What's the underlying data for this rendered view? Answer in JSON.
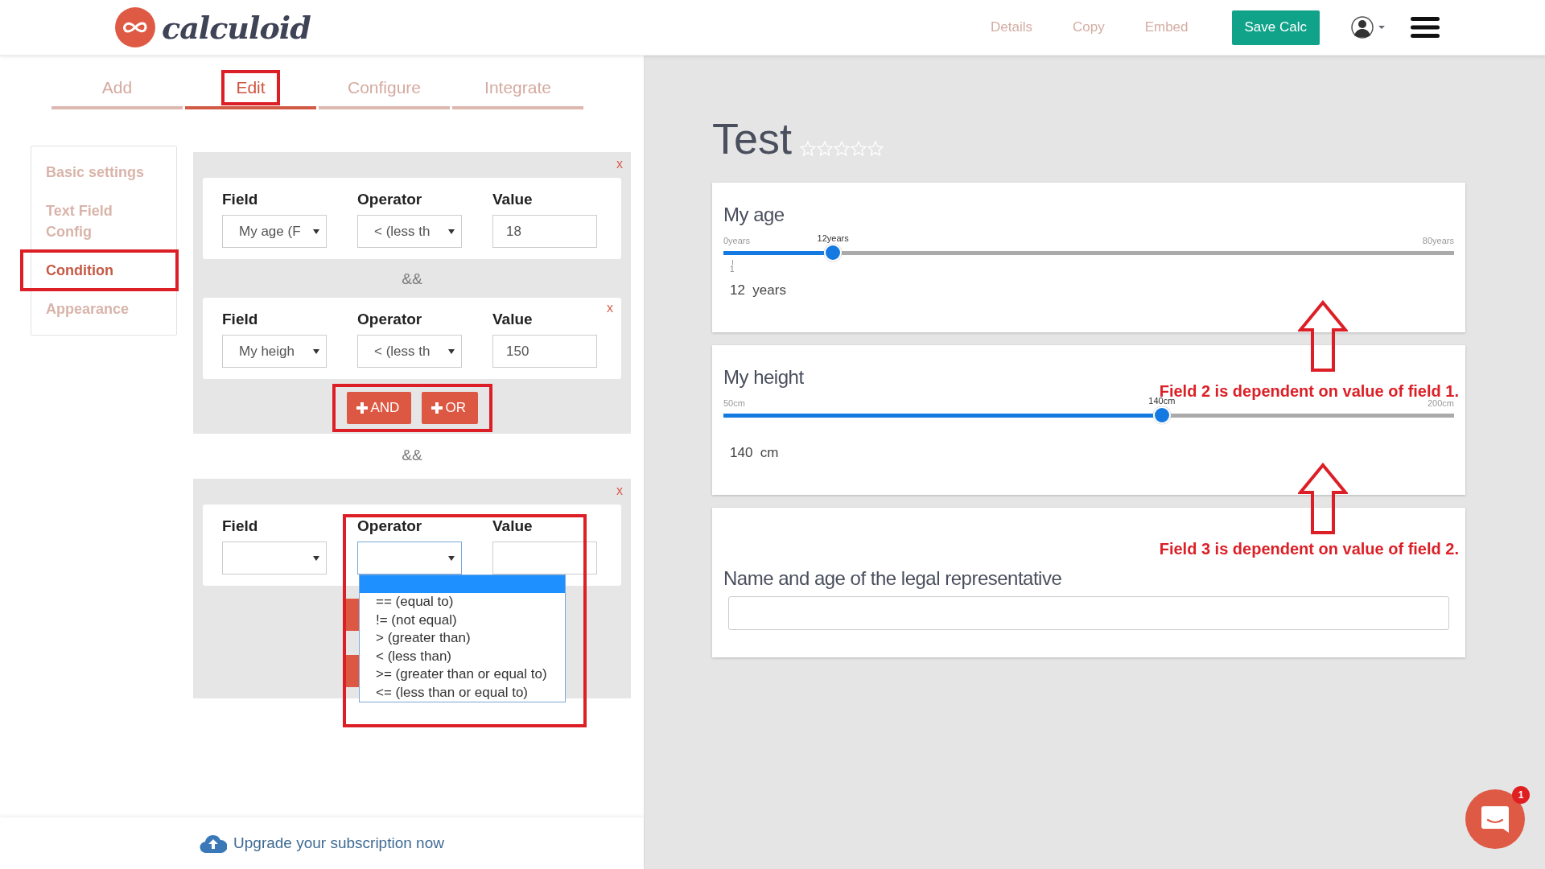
{
  "header": {
    "logo_text": "calculoid",
    "nav": [
      "Details",
      "Copy",
      "Embed"
    ],
    "save_button": "Save Calc"
  },
  "tabs": [
    {
      "label": "Add",
      "selected": false,
      "highlighted": false
    },
    {
      "label": "Edit",
      "selected": true,
      "highlighted": true
    },
    {
      "label": "Configure",
      "selected": false,
      "highlighted": false
    },
    {
      "label": "Integrate",
      "selected": false,
      "highlighted": false
    }
  ],
  "sidebar": {
    "items": [
      {
        "label": "Basic settings",
        "selected": false,
        "highlighted": false
      },
      {
        "label": "Text Field Config",
        "selected": false,
        "highlighted": false
      },
      {
        "label": "Condition",
        "selected": true,
        "highlighted": true
      },
      {
        "label": "Appearance",
        "selected": false,
        "highlighted": false
      }
    ]
  },
  "condition_groups": [
    {
      "close": "x",
      "rules": [
        {
          "labels": [
            "Field",
            "Operator",
            "Value"
          ],
          "field": "My age (F",
          "operator": "< (less th",
          "value": "18",
          "highlighted": false
        },
        {
          "labels": [
            "Field",
            "Operator",
            "Value"
          ],
          "field": "My heigh",
          "operator": "< (less th",
          "value": "150",
          "remove": "x",
          "highlighted": false
        }
      ],
      "joiner": "&&",
      "buttons": {
        "highlighted": true,
        "items": [
          {
            "kind": "and",
            "label": "AND"
          },
          {
            "kind": "or",
            "label": "OR"
          }
        ]
      }
    },
    {
      "close": "x",
      "rules": [
        {
          "labels": [
            "Field",
            "Operator",
            "Value"
          ],
          "highlighted": true,
          "dropdown": {
            "blank_selected": true,
            "options": [
              {
                "label": "== (equal to)",
                "selected": false
              },
              {
                "label": "!= (not equal)",
                "selected": false
              },
              {
                "label": "> (greater than)",
                "selected": false
              },
              {
                "label": "< (less than)",
                "selected": false
              },
              {
                "label": ">= (greater than or equal to)",
                "selected": false
              },
              {
                "label": "<= (less than or equal to)",
                "selected": false
              }
            ]
          }
        }
      ],
      "buttons": {
        "items": [
          {
            "kind": "and"
          },
          {
            "kind": "or"
          }
        ]
      }
    }
  ],
  "group_joiner": "&&",
  "footer": {
    "upgrade_link": "Upgrade your subscription now"
  },
  "preview": {
    "title": "Test",
    "stars": 0,
    "fields": [
      {
        "kind": "slider",
        "label": "My age",
        "min_label": "0years",
        "max_label": "80years",
        "thumb_label": "12years",
        "tick": "1",
        "level": 0.15,
        "reading": "12  years"
      },
      {
        "kind": "slider",
        "label": "My height",
        "min_label": "50cm",
        "max_label": "200cm",
        "thumb_label": "140cm",
        "level": 0.6,
        "reading": "140  cm",
        "note": "Field 2 is dependent on value of field 1."
      },
      {
        "kind": "text",
        "label": "Name and age of the legal representative",
        "note": "Field 3 is dependent on value of field 2."
      }
    ]
  },
  "chat": {
    "badge": "1"
  }
}
